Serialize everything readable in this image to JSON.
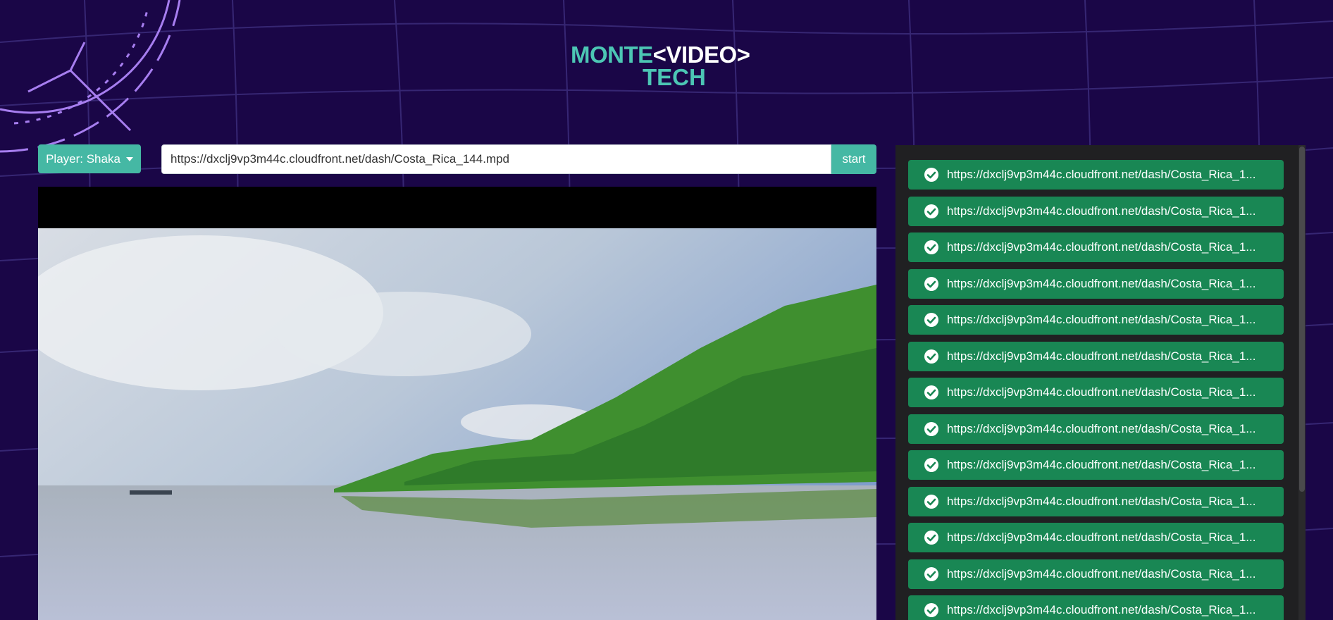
{
  "logo": {
    "part_monte": "MONTE",
    "part_video": "<VIDEO>",
    "part_tech": "TECH",
    "colors": {
      "teal": "#4cc6b4",
      "white": "#ffffff"
    }
  },
  "player_selector": {
    "label": "Player: Shaka",
    "icon": "caret-down-icon"
  },
  "url_input": {
    "value": "https://dxclj9vp3m44c.cloudfront.net/dash/Costa_Rica_144.mpd"
  },
  "start_button": {
    "label": "start"
  },
  "stream_list": {
    "status_icon": "check-circle-icon",
    "items": [
      {
        "label": "https://dxclj9vp3m44c.cloudfront.net/dash/Costa_Rica_1..."
      },
      {
        "label": "https://dxclj9vp3m44c.cloudfront.net/dash/Costa_Rica_1..."
      },
      {
        "label": "https://dxclj9vp3m44c.cloudfront.net/dash/Costa_Rica_1..."
      },
      {
        "label": "https://dxclj9vp3m44c.cloudfront.net/dash/Costa_Rica_1..."
      },
      {
        "label": "https://dxclj9vp3m44c.cloudfront.net/dash/Costa_Rica_1..."
      },
      {
        "label": "https://dxclj9vp3m44c.cloudfront.net/dash/Costa_Rica_1..."
      },
      {
        "label": "https://dxclj9vp3m44c.cloudfront.net/dash/Costa_Rica_1..."
      },
      {
        "label": "https://dxclj9vp3m44c.cloudfront.net/dash/Costa_Rica_1..."
      },
      {
        "label": "https://dxclj9vp3m44c.cloudfront.net/dash/Costa_Rica_1..."
      },
      {
        "label": "https://dxclj9vp3m44c.cloudfront.net/dash/Costa_Rica_1..."
      },
      {
        "label": "https://dxclj9vp3m44c.cloudfront.net/dash/Costa_Rica_1..."
      },
      {
        "label": "https://dxclj9vp3m44c.cloudfront.net/dash/Costa_Rica_1..."
      },
      {
        "label": "https://dxclj9vp3m44c.cloudfront.net/dash/Costa_Rica_1..."
      }
    ]
  },
  "colors": {
    "background": "#1a0647",
    "accent": "#45b8a4",
    "item_success": "#198754",
    "panel": "#202022"
  }
}
